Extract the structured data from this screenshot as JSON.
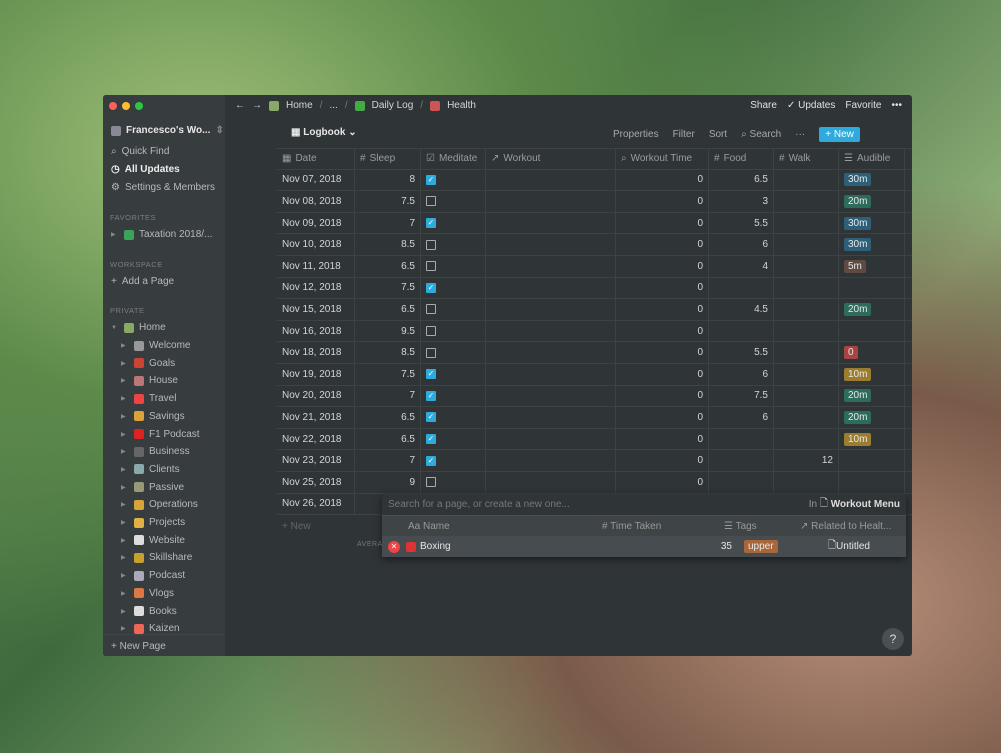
{
  "sidebar": {
    "workspace": "Francesco's Wo...",
    "quick_find": "Quick Find",
    "all_updates": "All Updates",
    "settings": "Settings & Members",
    "favorites_label": "FAVORITES",
    "favorites": [
      {
        "label": "Taxation 2018/...",
        "color": "#3aa55a"
      }
    ],
    "workspace_label": "WORKSPACE",
    "add_page": "Add a Page",
    "private_label": "PRIVATE",
    "home": "Home",
    "pages": [
      {
        "label": "Welcome",
        "color": "#999"
      },
      {
        "label": "Goals",
        "color": "#c43"
      },
      {
        "label": "House",
        "color": "#b77"
      },
      {
        "label": "Travel",
        "color": "#e44"
      },
      {
        "label": "Savings",
        "color": "#d9a33a"
      },
      {
        "label": "F1 Podcast",
        "color": "#d22"
      },
      {
        "label": "Business",
        "color": "#666"
      },
      {
        "label": "Clients",
        "color": "#8aa"
      },
      {
        "label": "Passive",
        "color": "#997"
      },
      {
        "label": "Operations",
        "color": "#d9a33a"
      },
      {
        "label": "Projects",
        "color": "#e0b040"
      },
      {
        "label": "Website",
        "color": "#ddd"
      },
      {
        "label": "Skillshare",
        "color": "#c9a030"
      },
      {
        "label": "Podcast",
        "color": "#aab"
      },
      {
        "label": "Vlogs",
        "color": "#d74"
      },
      {
        "label": "Books",
        "color": "#ddd"
      },
      {
        "label": "Kaizen",
        "color": "#e65"
      }
    ],
    "new_page": "New Page"
  },
  "topbar": {
    "breadcrumb": [
      "Home",
      "...",
      "Daily Log",
      "Health"
    ],
    "share": "Share",
    "updates": "Updates",
    "favorite": "Favorite",
    "more": "•••"
  },
  "toolbar": {
    "view": "Logbook",
    "properties": "Properties",
    "filter": "Filter",
    "sort": "Sort",
    "search": "Search",
    "more": "···",
    "new": "New"
  },
  "table": {
    "columns": [
      "Date",
      "Sleep",
      "Meditate",
      "Workout",
      "Workout Time",
      "Food",
      "Walk",
      "Audible"
    ],
    "column_icons": [
      "▦",
      "#",
      "☑",
      "↗",
      "⌕",
      "#",
      "#",
      "☰"
    ],
    "rows": [
      [
        "Nov 07, 2018",
        "8",
        true,
        "",
        "0",
        "6.5",
        "",
        "30m"
      ],
      [
        "Nov 08, 2018",
        "7.5",
        false,
        "",
        "0",
        "3",
        "",
        "20m"
      ],
      [
        "Nov 09, 2018",
        "7",
        true,
        "",
        "0",
        "5.5",
        "",
        "30m"
      ],
      [
        "Nov 10, 2018",
        "8.5",
        false,
        "",
        "0",
        "6",
        "",
        "30m"
      ],
      [
        "Nov 11, 2018",
        "6.5",
        false,
        "",
        "0",
        "4",
        "",
        "5m"
      ],
      [
        "Nov 12, 2018",
        "7.5",
        true,
        "",
        "0",
        "",
        "",
        ""
      ],
      [
        "Nov 15, 2018",
        "6.5",
        false,
        "",
        "0",
        "4.5",
        "",
        "20m"
      ],
      [
        "Nov 16, 2018",
        "9.5",
        false,
        "",
        "0",
        "",
        "",
        ""
      ],
      [
        "Nov 18, 2018",
        "8.5",
        false,
        "",
        "0",
        "5.5",
        "",
        "0"
      ],
      [
        "Nov 19, 2018",
        "7.5",
        true,
        "",
        "0",
        "6",
        "",
        "10m"
      ],
      [
        "Nov 20, 2018",
        "7",
        true,
        "",
        "0",
        "7.5",
        "",
        "20m"
      ],
      [
        "Nov 21, 2018",
        "6.5",
        true,
        "",
        "0",
        "6",
        "",
        "20m"
      ],
      [
        "Nov 22, 2018",
        "6.5",
        true,
        "",
        "0",
        "",
        "",
        "10m"
      ],
      [
        "Nov 23, 2018",
        "7",
        true,
        "",
        "0",
        "",
        "12",
        ""
      ],
      [
        "Nov 25, 2018",
        "9",
        false,
        "",
        "0",
        "",
        "",
        ""
      ],
      [
        "Nov 26, 2018",
        "",
        null,
        "",
        "",
        "",
        "",
        ""
      ]
    ],
    "tag_colors": {
      "30m": "#2d5f78",
      "20m": "#2d6b5c",
      "5m": "#5e4a40",
      "0": "#a84444",
      "10m": "#9a7d2e"
    },
    "add_row": "New",
    "footer": "AVERAGE"
  },
  "popup": {
    "placeholder": "Search for a page, or create a new one...",
    "in_label": "In",
    "target": "Workout Menu",
    "columns": [
      "Name",
      "Time Taken",
      "Tags",
      "Related to Healt..."
    ],
    "item": {
      "name": "Boxing",
      "time": "35",
      "tag": "upper",
      "tag_color": "#a8663a",
      "related": "Untitled"
    }
  },
  "help": "?"
}
